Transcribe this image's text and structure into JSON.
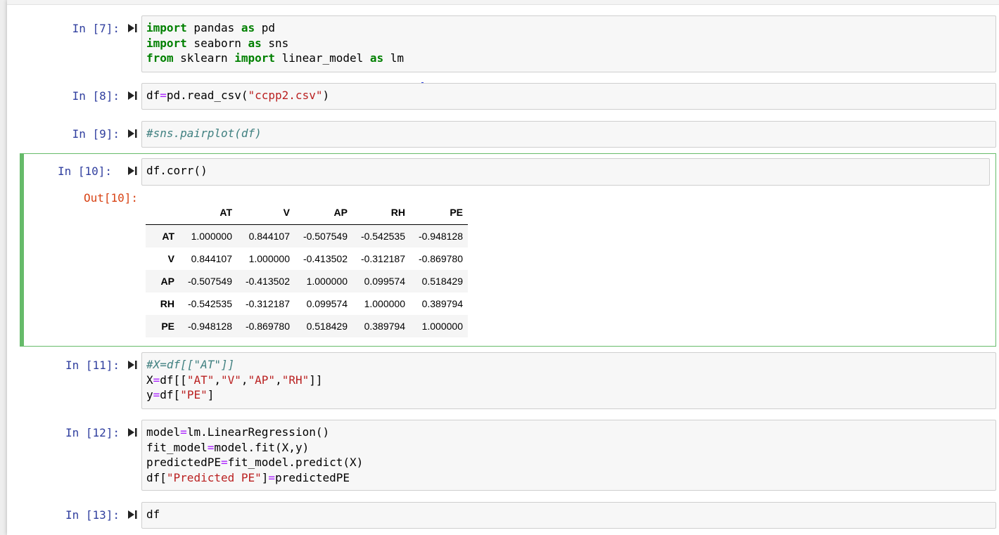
{
  "cells": {
    "c7": {
      "prompt": "In [7]:",
      "lines": [
        [
          {
            "t": "import",
            "c": "kw"
          },
          {
            "t": " pandas "
          },
          {
            "t": "as",
            "c": "kw"
          },
          {
            "t": " pd"
          }
        ],
        [
          {
            "t": "import",
            "c": "kw"
          },
          {
            "t": " seaborn "
          },
          {
            "t": "as",
            "c": "kw"
          },
          {
            "t": " sns"
          }
        ],
        [
          {
            "t": "from",
            "c": "kw"
          },
          {
            "t": " sklearn "
          },
          {
            "t": "import",
            "c": "kw"
          },
          {
            "t": " linear_model "
          },
          {
            "t": "as",
            "c": "kw"
          },
          {
            "t": " lm"
          }
        ]
      ]
    },
    "c8": {
      "prompt": "In [8]:",
      "lines": [
        [
          {
            "t": "df"
          },
          {
            "t": "=",
            "c": "op"
          },
          {
            "t": "pd.read_csv("
          },
          {
            "t": "\"ccpp2.csv\"",
            "c": "str"
          },
          {
            "t": ")"
          }
        ]
      ]
    },
    "c9": {
      "prompt": "In [9]:",
      "lines": [
        [
          {
            "t": "#sns.pairplot(df)",
            "c": "cm"
          }
        ]
      ]
    },
    "c10": {
      "prompt": "In [10]:",
      "out_prompt": "Out[10]:",
      "lines": [
        [
          {
            "t": "df.corr()"
          }
        ]
      ],
      "table": {
        "columns": [
          "",
          "AT",
          "V",
          "AP",
          "RH",
          "PE"
        ],
        "rows": [
          {
            "index": "AT",
            "values": [
              "1.000000",
              "0.844107",
              "-0.507549",
              "-0.542535",
              "-0.948128"
            ]
          },
          {
            "index": "V",
            "values": [
              "0.844107",
              "1.000000",
              "-0.413502",
              "-0.312187",
              "-0.869780"
            ]
          },
          {
            "index": "AP",
            "values": [
              "-0.507549",
              "-0.413502",
              "1.000000",
              "0.099574",
              "0.518429"
            ]
          },
          {
            "index": "RH",
            "values": [
              "-0.542535",
              "-0.312187",
              "0.099574",
              "1.000000",
              "0.389794"
            ]
          },
          {
            "index": "PE",
            "values": [
              "-0.948128",
              "-0.869780",
              "0.518429",
              "0.389794",
              "1.000000"
            ]
          }
        ]
      }
    },
    "c11": {
      "prompt": "In [11]:",
      "lines": [
        [
          {
            "t": "#X=df[[\"AT\"]]",
            "c": "cm"
          }
        ],
        [
          {
            "t": "X"
          },
          {
            "t": "=",
            "c": "op"
          },
          {
            "t": "df[["
          },
          {
            "t": "\"AT\"",
            "c": "str"
          },
          {
            "t": ","
          },
          {
            "t": "\"V\"",
            "c": "str"
          },
          {
            "t": ","
          },
          {
            "t": "\"AP\"",
            "c": "str"
          },
          {
            "t": ","
          },
          {
            "t": "\"RH\"",
            "c": "str"
          },
          {
            "t": "]]"
          }
        ],
        [
          {
            "t": "y"
          },
          {
            "t": "=",
            "c": "op"
          },
          {
            "t": "df["
          },
          {
            "t": "\"PE\"",
            "c": "str"
          },
          {
            "t": "]"
          }
        ]
      ]
    },
    "c12": {
      "prompt": "In [12]:",
      "lines": [
        [
          {
            "t": "model"
          },
          {
            "t": "=",
            "c": "op"
          },
          {
            "t": "lm.LinearRegression()"
          }
        ],
        [
          {
            "t": "fit_model"
          },
          {
            "t": "=",
            "c": "op"
          },
          {
            "t": "model.fit(X,y)"
          }
        ],
        [
          {
            "t": "predictedPE"
          },
          {
            "t": "=",
            "c": "op"
          },
          {
            "t": "fit_model.predict(X)"
          }
        ],
        [
          {
            "t": "df["
          },
          {
            "t": "\"Predicted PE\"",
            "c": "str"
          },
          {
            "t": "]"
          },
          {
            "t": "=",
            "c": "op"
          },
          {
            "t": "predictedPE"
          }
        ]
      ]
    },
    "c13": {
      "prompt": "In [13]:",
      "lines": [
        [
          {
            "t": "df"
          }
        ]
      ]
    }
  },
  "colors": {
    "prompt_in": "#303f9f",
    "prompt_out": "#d84315",
    "selected_border": "#66bb6a",
    "keyword": "#008000",
    "string": "#ba2121",
    "operator": "#aa22ff",
    "comment": "#408080"
  },
  "icons": {
    "run": "run-cell-icon"
  }
}
